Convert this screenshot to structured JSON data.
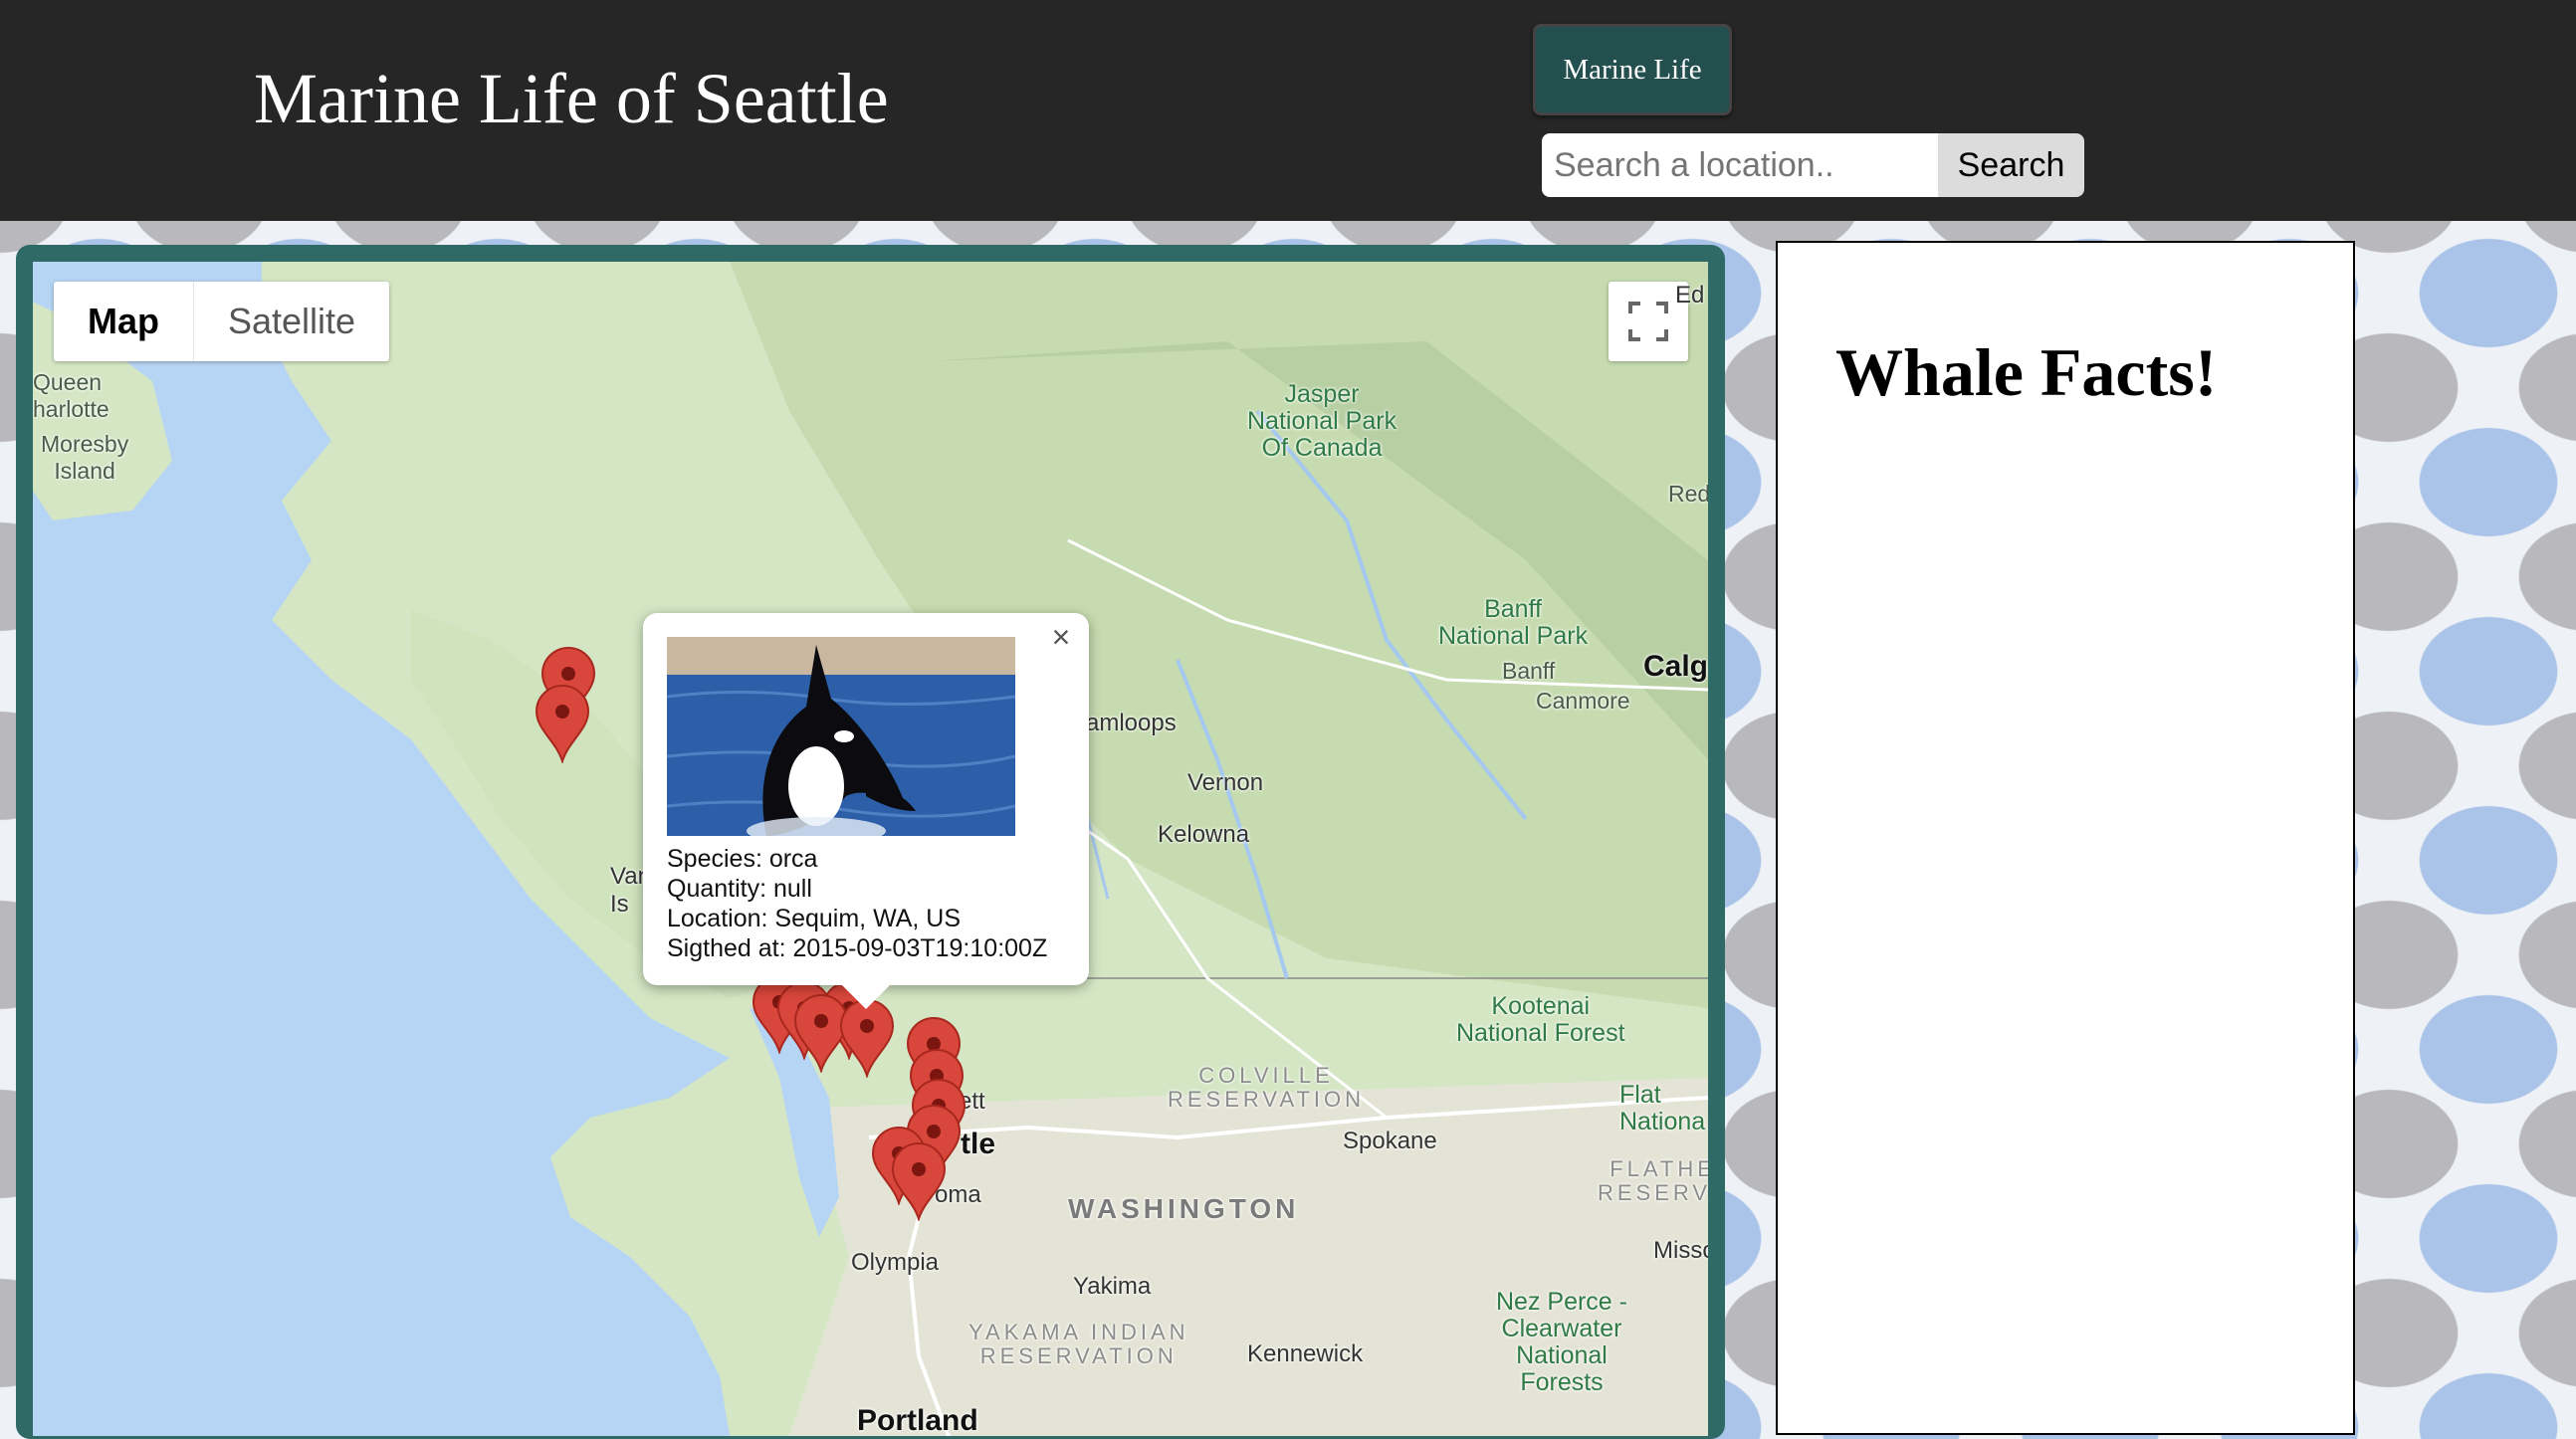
{
  "header": {
    "title": "Marine Life of Seattle",
    "nav_button": "Marine Life",
    "search_placeholder": "Search a location..",
    "search_button": "Search"
  },
  "map": {
    "map_type_active": "Map",
    "map_type_other": "Satellite",
    "labels": {
      "queen_charlotte": "Queen\nharlotte",
      "moresby": "Moresby\nIsland",
      "jasper": "Jasper\nNational Park\nOf Canada",
      "banff_park": "Banff\nNational Park",
      "banff": "Banff",
      "canmore": "Canmore",
      "calgary": "Calga",
      "red": "Red",
      "ed": "Ed",
      "kamloops": "amloops",
      "vernon": "Vernon",
      "kelowna": "Kelowna",
      "kootenai": "Kootenai\nNational Forest",
      "colville": "COLVILLE\nRESERVATION",
      "spokane": "Spokane",
      "washington": "WASHINGTON",
      "flathead": "FLATHE\nRESERVA",
      "flat": "Flat\nNationa",
      "seattle": "tle",
      "everett": "rett",
      "tacoma": "oma",
      "olympia": "Olympia",
      "yakima": "Yakima",
      "yakama": "YAKAMA INDIAN\nRESERVATION",
      "kennewick": "Kennewick",
      "nezperce": "Nez Perce -\nClearwater\nNational\nForests",
      "portland": "Portland",
      "van": "Van\nIs",
      "misso": "Misso"
    }
  },
  "info_window": {
    "species": "Species: orca",
    "quantity": "Quantity: null",
    "location": "Location: Sequim, WA, US",
    "sighted": "Sigthed at: 2015-09-03T19:10:00Z",
    "close": "×"
  },
  "facts": {
    "title": "Whale Facts!"
  },
  "colors": {
    "header_bg": "#262626",
    "nav_button_bg": "#234f4f",
    "map_frame": "#2f6a66",
    "marker": "#d9463b"
  }
}
